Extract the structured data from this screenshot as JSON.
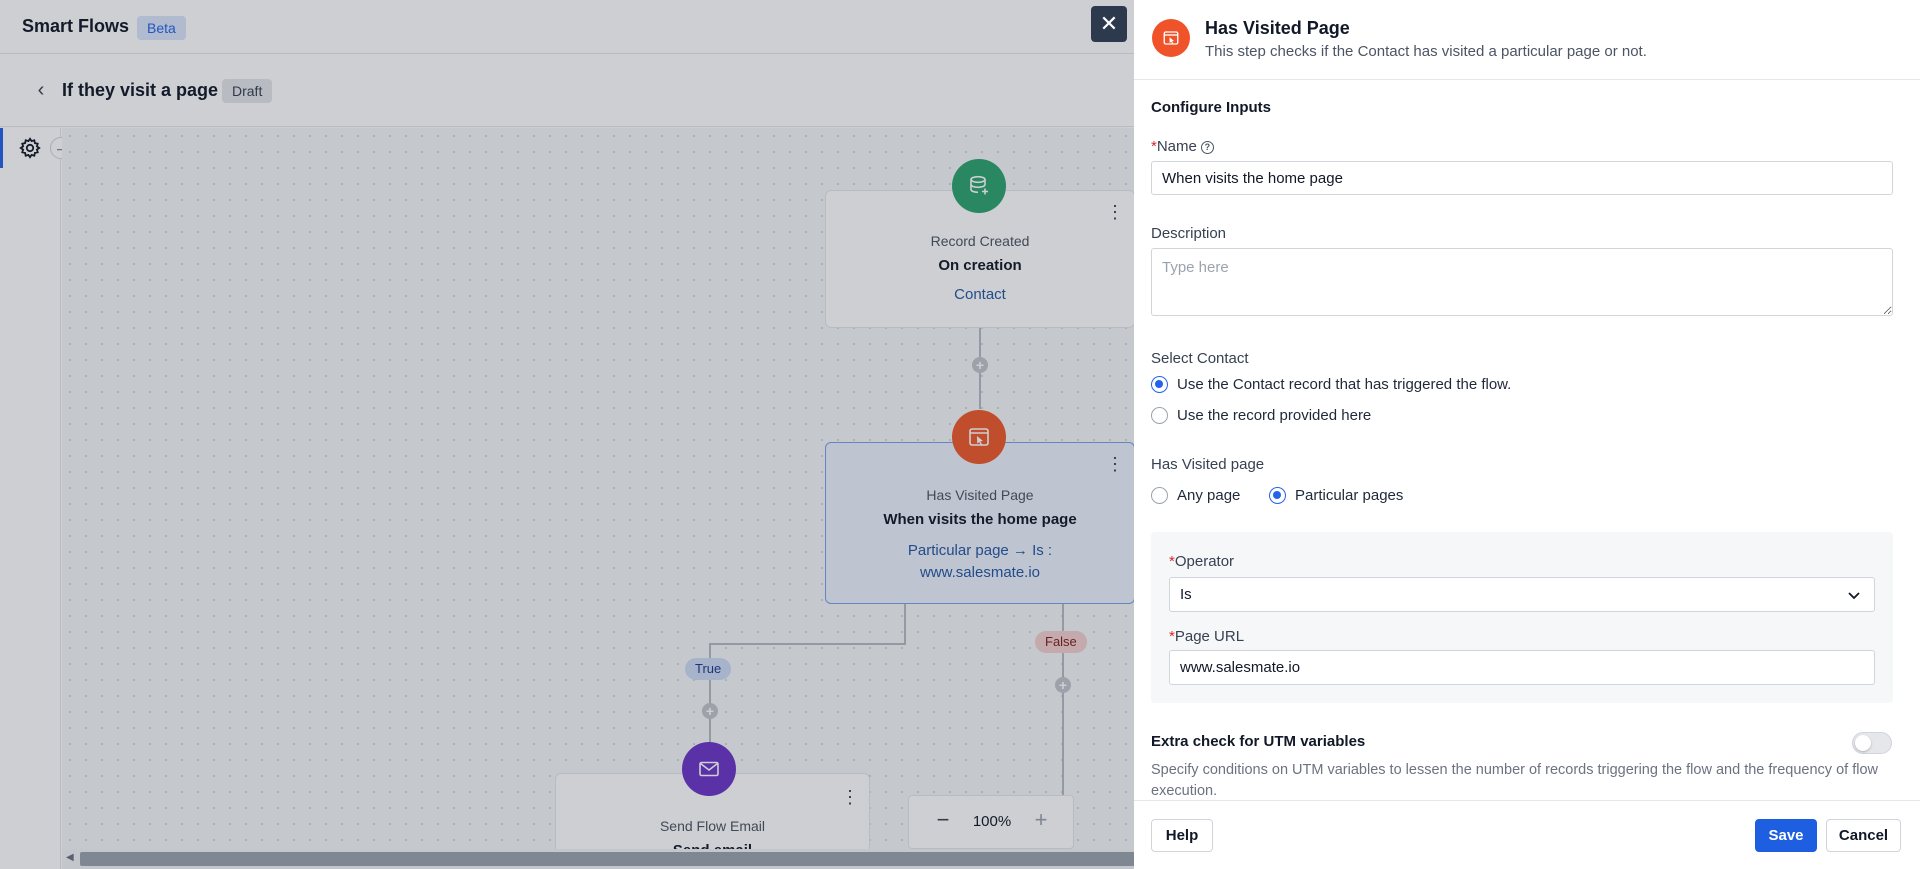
{
  "app": {
    "title": "Smart Flows",
    "badge": "Beta"
  },
  "flow": {
    "title": "If they visit a page",
    "status": "Draft"
  },
  "canvas": {
    "nodes": [
      {
        "type": "Record Created",
        "name": "On creation",
        "detail": "Contact",
        "icon": "database-plus-icon",
        "color": "#2ea36f"
      },
      {
        "type": "Has Visited Page",
        "name": "When visits the home page",
        "detail_line1": "Particular page → Is :",
        "detail_line2": "www.salesmate.io",
        "icon": "page-visit-icon",
        "color": "#ef5a2c"
      },
      {
        "type": "Send Flow Email",
        "name": "Send email",
        "icon": "mail-icon",
        "color": "#6d35c9"
      }
    ],
    "branches": {
      "true_label": "True",
      "false_label": "False"
    },
    "zoom": "100%"
  },
  "panel": {
    "title": "Has Visited Page",
    "subtitle": "This step checks if the Contact has visited a particular page or not.",
    "section_title": "Configure Inputs",
    "name_label": "Name",
    "name_value": "When visits the home page",
    "description_label": "Description",
    "description_placeholder": "Type here",
    "select_contact_label": "Select Contact",
    "contact_options": [
      {
        "label": "Use the Contact record that has triggered the flow.",
        "selected": true
      },
      {
        "label": "Use the record provided here",
        "selected": false
      }
    ],
    "visited_label": "Has Visited page",
    "visited_options": [
      {
        "label": "Any page",
        "selected": false
      },
      {
        "label": "Particular pages",
        "selected": true
      }
    ],
    "operator_label": "Operator",
    "operator_value": "Is",
    "page_url_label": "Page URL",
    "page_url_value": "www.salesmate.io",
    "utm_title": "Extra check for UTM variables",
    "utm_enabled": false,
    "utm_description": "Specify conditions on UTM variables to lessen the number of records triggering the flow and the frequency of flow execution.",
    "buttons": {
      "help": "Help",
      "save": "Save",
      "cancel": "Cancel"
    }
  },
  "colors": {
    "primary": "#1d5fe0",
    "panel_icon": "#f0522a",
    "required": "#dc2626"
  }
}
